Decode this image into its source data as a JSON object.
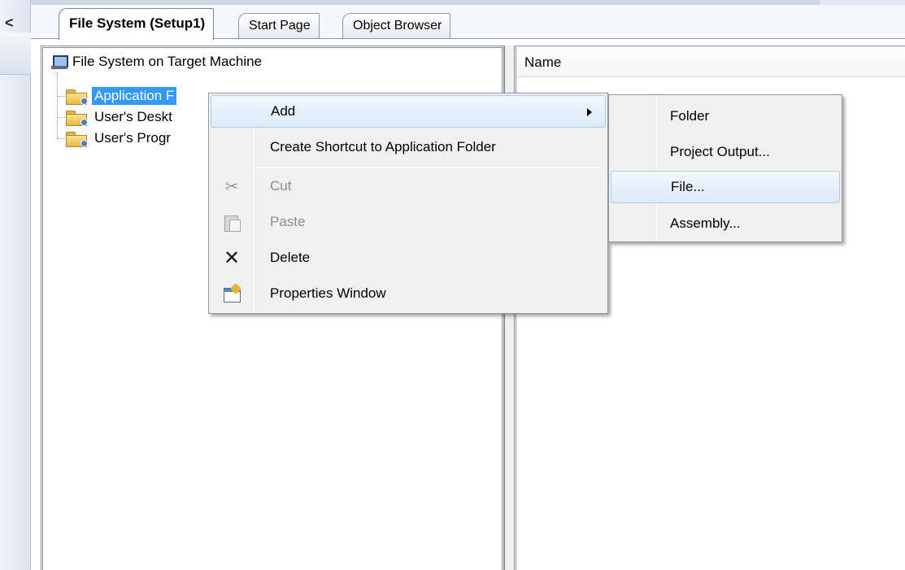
{
  "tabs": [
    {
      "label": "File System (Setup1)",
      "active": true
    },
    {
      "label": "Start Page",
      "active": false
    },
    {
      "label": "Object Browser",
      "active": false
    }
  ],
  "left_chrome": {
    "collapse_glyph": "<"
  },
  "tree": {
    "root_label": "File System on Target Machine",
    "root_icon": "computer-icon",
    "items": [
      {
        "label": "Application Folder",
        "visible_text": "Application F",
        "selected": true,
        "icon": "folder-icon"
      },
      {
        "label": "User's Deskt",
        "selected": false,
        "icon": "folder-icon"
      },
      {
        "label": "User's Progr",
        "selected": false,
        "icon": "folder-icon"
      }
    ]
  },
  "list": {
    "columns": [
      "Name"
    ]
  },
  "context_menu": {
    "items": [
      {
        "label": "Add",
        "has_submenu": true,
        "hover": true
      },
      {
        "label": "Create Shortcut to Application Folder"
      },
      {
        "label": "Cut",
        "icon": "scissors-icon",
        "disabled": true
      },
      {
        "label": "Paste",
        "icon": "paste-icon",
        "disabled": true
      },
      {
        "label": "Delete",
        "icon": "delete-icon"
      },
      {
        "label": "Properties Window",
        "icon": "properties-icon"
      }
    ]
  },
  "submenu": {
    "items": [
      {
        "label": "Folder"
      },
      {
        "label": "Project Output..."
      },
      {
        "label": "File...",
        "hover": true
      },
      {
        "label": "Assembly..."
      }
    ]
  },
  "colors": {
    "selection": "#3399ff",
    "menu_bg": "#f0f0f0",
    "menu_hover_border": "#a8cbf0",
    "disabled_text": "#8d8d8d"
  }
}
